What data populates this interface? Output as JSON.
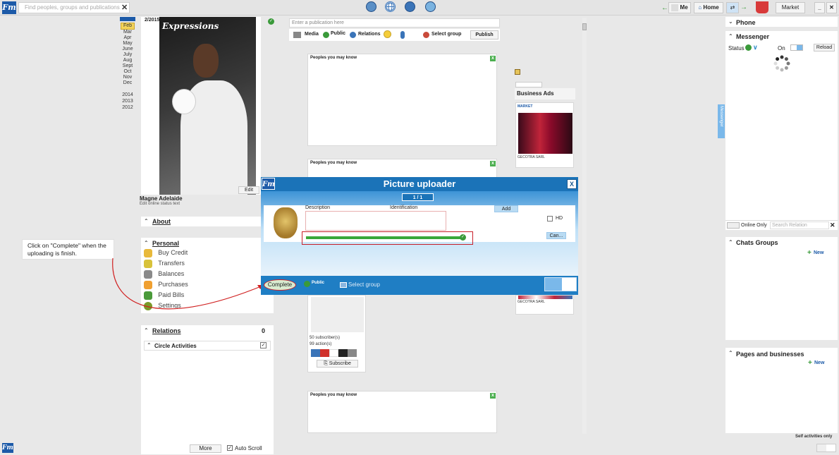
{
  "topbar": {
    "search_placeholder": "Find peoples, groups and publications",
    "me_label": "Me",
    "home_label": "Home",
    "market_label": "Market"
  },
  "profile": {
    "photo_date": "2/2015",
    "photo_caption": "Expressions",
    "months": [
      "Feb",
      "Mar",
      "Apr",
      "May",
      "June",
      "July",
      "Aug",
      "Sept",
      "Oct",
      "Nov",
      "Dec"
    ],
    "years": [
      "2014",
      "2013",
      "2012"
    ],
    "edit_label": "Edit",
    "name": "Magne Adelaide",
    "status_text": "Edit online status text",
    "about_label": "About",
    "personal_label": "Personal",
    "menu": [
      "Buy Credit",
      "Transfers",
      "Balances",
      "Purchases",
      "Paid Bills",
      "Settings"
    ],
    "relations_label": "Relations",
    "relations_count": "0",
    "circle_label": "Circle Activities",
    "more_label": "More",
    "autoscroll_label": "Auto Scroll"
  },
  "callout": {
    "text": "Click on \"Complete\" when the uploading is finish."
  },
  "publish": {
    "placeholder": "Enter a publication here",
    "media": "Media",
    "public": "Public",
    "relations": "Relations",
    "select_group": "Select group",
    "publish_btn": "Publish"
  },
  "feed": {
    "card_title": "Peoples you may know",
    "subscribers": "50 subscriber(s)",
    "actions": "99 action(s)",
    "subscribe": "Subscribe"
  },
  "ads": {
    "header": "Business Ads",
    "market": "MARKET",
    "company": "GECOTRA SARL",
    "company2": "GECOTRA SARL"
  },
  "dialog": {
    "title": "Picture uploader",
    "counter": "1 / 1",
    "description": "Description",
    "identification": "Identification",
    "add": "Add",
    "hd": "HD",
    "cancel": "Can...",
    "progress": 1.0,
    "complete": "Complete",
    "public": "Public",
    "select_group": "Select group"
  },
  "right": {
    "phone": "Phone",
    "messenger": "Messenger",
    "status": "Status",
    "on": "On",
    "reload": "Reload",
    "online_only": "Online Only",
    "search_relation": "Search Relation",
    "chats_groups": "Chats Groups",
    "new1": "New",
    "pages": "Pages and businesses",
    "new2": "New",
    "self_activities": "Self activities only",
    "side_tab": "Messenger"
  }
}
